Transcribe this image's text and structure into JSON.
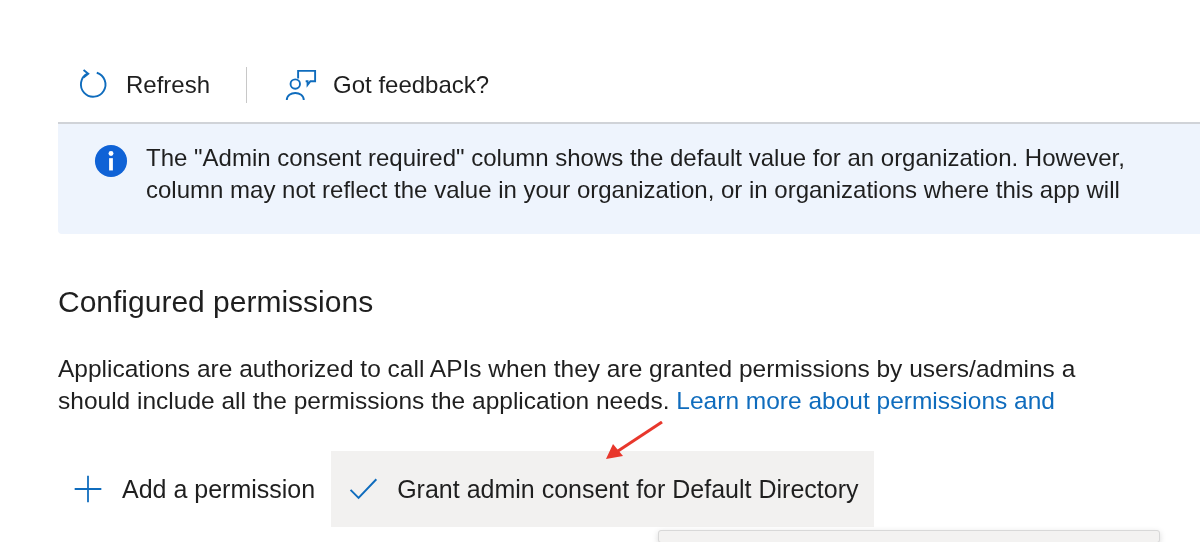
{
  "toolbar": [
    {
      "kind": "refresh",
      "label": "Refresh"
    },
    {
      "kind": "feedback",
      "label": "Got feedback?"
    }
  ],
  "info_banner": {
    "lines": [
      "The \"Admin consent required\" column shows the default value for an organization. However,",
      "column may not reflect the value in your organization, or in organizations where this app will"
    ]
  },
  "section": {
    "title": "Configured permissions",
    "lines": [
      "Applications are authorized to call APIs when they are granted permissions by users/admins a",
      "should include all the permissions the application needs."
    ],
    "link": "Learn more about permissions and"
  },
  "actions": [
    {
      "kind": "add",
      "label": "Add a permission",
      "highlighted": false
    },
    {
      "kind": "check",
      "label": "Grant admin consent for Default Directory",
      "highlighted": true
    }
  ]
}
